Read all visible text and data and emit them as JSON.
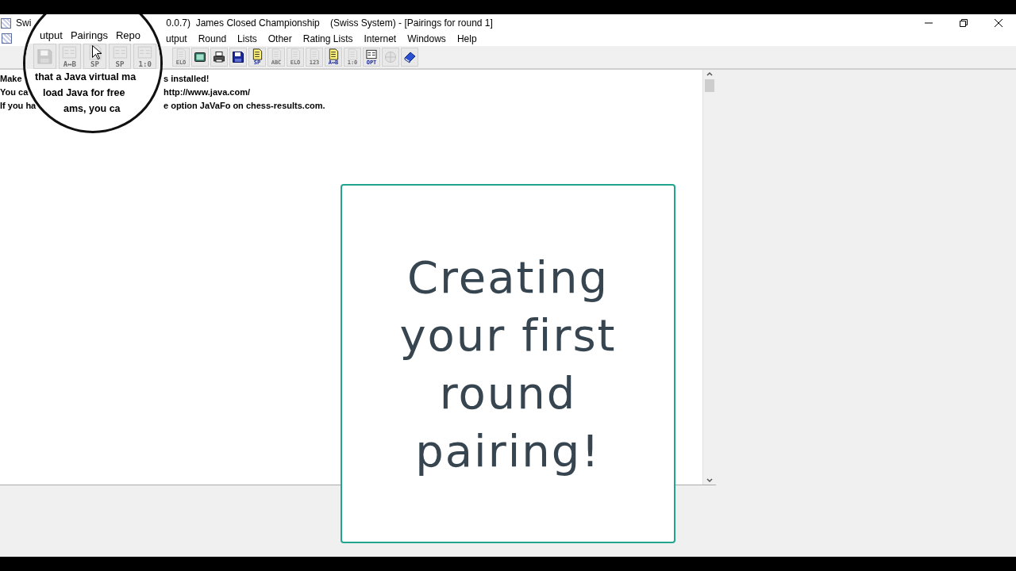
{
  "window": {
    "title_start": "Swi",
    "title": "0.0.7)  James Closed Championship    (Swiss System) - [Pairings for round 1]"
  },
  "menu": [
    "utput",
    "Round",
    "Lists",
    "Other",
    "Rating Lists",
    "Internet",
    "Windows",
    "Help"
  ],
  "toolbar": [
    {
      "kind": "doc",
      "label": "ELO",
      "disabled": true
    },
    {
      "kind": "screen",
      "disabled": false
    },
    {
      "kind": "printer",
      "disabled": false
    },
    {
      "kind": "floppy",
      "disabled": false
    },
    {
      "kind": "doc",
      "label": "SP",
      "disabled": false
    },
    {
      "kind": "doc",
      "label": "ABC",
      "disabled": true
    },
    {
      "kind": "doc",
      "label": "ELO",
      "disabled": true
    },
    {
      "kind": "doc",
      "label": "123",
      "disabled": true
    },
    {
      "kind": "doc",
      "label": "A↔B",
      "disabled": false
    },
    {
      "kind": "doc",
      "label": "1:0",
      "disabled": true
    },
    {
      "kind": "form",
      "label": "OPT",
      "disabled": false
    },
    {
      "kind": "globe",
      "disabled": true
    },
    {
      "kind": "book",
      "disabled": false
    }
  ],
  "messages": [
    {
      "start": "Make",
      "end": "s installed!"
    },
    {
      "start": "You ca",
      "end": "http://www.java.com/"
    },
    {
      "start": "If you ha",
      "end": "e option JaVaFo on chess-results.com."
    }
  ],
  "magnifier": {
    "menu": [
      "utput",
      "Pairings",
      "Repo"
    ],
    "toolbar": [
      {
        "kind": "floppy",
        "disabled": true
      },
      {
        "kind": "form",
        "label": "A↔B",
        "disabled": true
      },
      {
        "kind": "doc",
        "label": "SP",
        "disabled": true
      },
      {
        "kind": "form",
        "label": "SP",
        "disabled": true
      },
      {
        "kind": "form",
        "label": "1:0",
        "disabled": true
      }
    ],
    "lines": [
      "that a Java virtual ma",
      "load Java for free",
      "ams, you ca"
    ]
  },
  "overlay_card": {
    "text": "Creating your first round pairing!"
  }
}
